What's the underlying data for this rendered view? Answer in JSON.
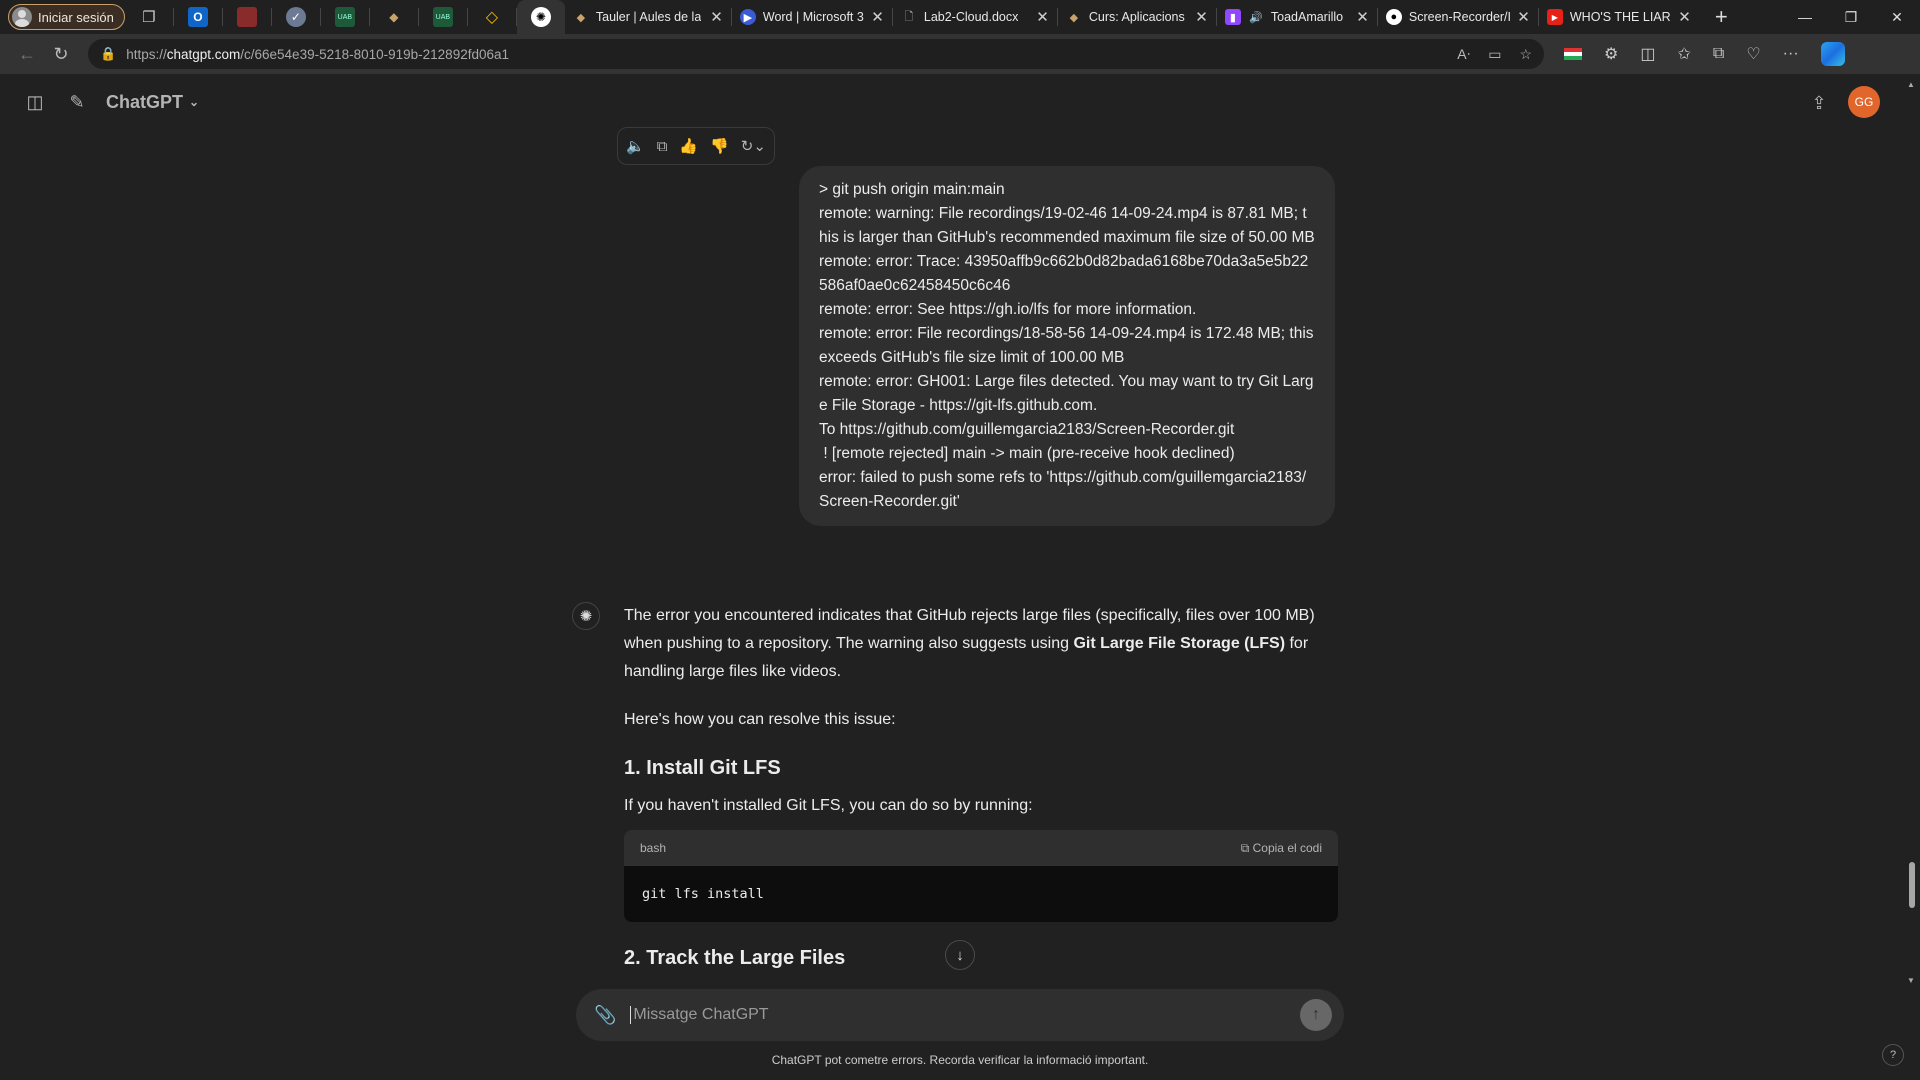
{
  "browser": {
    "profile_label": "Iniciar sesión",
    "tabs": [
      {
        "title": "Tauler | Aules de la",
        "close": "✕"
      },
      {
        "title": "Word | Microsoft 3",
        "close": "✕"
      },
      {
        "title": "Lab2-Cloud.docx",
        "close": "✕"
      },
      {
        "title": "Curs: Aplicacions d",
        "close": "✕"
      },
      {
        "title": "ToadAmarillo",
        "close": "✕"
      },
      {
        "title": "Screen-Recorder/I",
        "close": "✕"
      },
      {
        "title": "WHO'S THE LIAR |",
        "close": "✕"
      }
    ],
    "url_prefix": "https://",
    "url_host": "chatgpt.com",
    "url_path": "/c/66e54e39-5218-8010-919b-212892fd06a1"
  },
  "header": {
    "model_name": "ChatGPT",
    "avatar_initials": "GG"
  },
  "conversation": {
    "user_message": "> git push origin main:main\nremote: warning: File recordings/19-02-46 14-09-24.mp4 is 87.81 MB; this is larger than GitHub's recommended maximum file size of 50.00 MB\nremote: error: Trace: 43950affb9c662b0d82bada6168be70da3a5e5b22586af0ae0c62458450c6c46\nremote: error: See https://gh.io/lfs for more information.\nremote: error: File recordings/18-58-56 14-09-24.mp4 is 172.48 MB; this exceeds GitHub's file size limit of 100.00 MB\nremote: error: GH001: Large files detected. You may want to try Git Large File Storage - https://git-lfs.github.com.\nTo https://github.com/guillemgarcia2183/Screen-Recorder.git\n ! [remote rejected] main -> main (pre-receive hook declined)\nerror: failed to push some refs to 'https://github.com/guillemgarcia2183/Screen-Recorder.git'",
    "answer": {
      "intro_a": "The error you encountered indicates that GitHub rejects large files (specifically, files over 100 MB) when pushing to a repository. The warning also suggests using ",
      "intro_bold": "Git Large File Storage (LFS)",
      "intro_b": " for handling large files like videos.",
      "resolve": "Here's how you can resolve this issue:",
      "step1_title": "1. Install Git LFS",
      "step1_text": "If you haven't installed Git LFS, you can do so by running:",
      "code_lang": "bash",
      "copy_label": "Copia el codi",
      "code": "git lfs install",
      "step2_title": "2. Track the Large Files"
    }
  },
  "composer": {
    "placeholder": "Missatge ChatGPT"
  },
  "disclaimer": "ChatGPT pot cometre errors. Recorda verificar la informació important.",
  "help_label": "?"
}
